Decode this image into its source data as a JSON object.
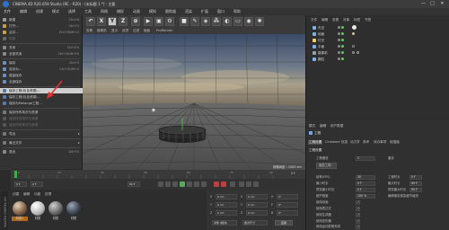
{
  "window": {
    "title": "CINEMA 4D R20.059 Studio (RC - R20) - [未标题 1 *] - 主要",
    "controls": [
      "—",
      "□",
      "✕"
    ]
  },
  "menubar": {
    "items": [
      "文件",
      "编辑",
      "创建",
      "模式",
      "选择",
      "工具",
      "网格",
      "捕捉",
      "动画",
      "模拟",
      "跟踪器",
      "渲染",
      "扩展",
      "窗口",
      "帮助"
    ]
  },
  "toolbar": {
    "buttons": [
      "X",
      "Y",
      "Z"
    ]
  },
  "file_menu": {
    "items": [
      {
        "label": "新建",
        "shortcut": "Ctrl+N"
      },
      {
        "label": "打开...",
        "shortcut": "Ctrl+O"
      },
      {
        "label": "合并...",
        "shortcut": "Ctrl+Shift+O"
      },
      {
        "label": "恢复",
        "shortcut": ""
      },
      {
        "label": "关闭",
        "shortcut": "Ctrl+F4"
      },
      {
        "label": "全部关闭",
        "shortcut": "Ctrl+Shift+F4"
      },
      {
        "label": "保存",
        "shortcut": "Ctrl+S"
      },
      {
        "label": "另存为...",
        "shortcut": "Ctrl+Shift+S"
      },
      {
        "label": "增量保存",
        "shortcut": ""
      },
      {
        "label": "全部保存",
        "shortcut": ""
      },
      {
        "label": "保存工程(包含资源)...",
        "shortcut": ""
      },
      {
        "label": "保存工程(包含资源)...",
        "shortcut": ""
      },
      {
        "label": "保存为Melange工程...",
        "shortcut": ""
      },
      {
        "label": "保存所有场次与资源",
        "shortcut": ""
      },
      {
        "label": "保存所有场次与资源",
        "shortcut": ""
      },
      {
        "label": "保存所有场次与资源",
        "shortcut": ""
      },
      {
        "label": "导出",
        "shortcut": ""
      },
      {
        "label": "最近文件",
        "shortcut": ""
      },
      {
        "label": "退出",
        "shortcut": "Alt+F4"
      }
    ]
  },
  "viewport": {
    "menu": [
      "查看",
      "摄像机",
      "显示",
      "选项",
      "过滤",
      "面板",
      "ProRender"
    ],
    "view_name": "透视视图",
    "grid_label": "网格间距 : 1000 cm"
  },
  "timeline": {
    "ticks": [
      "0",
      "5",
      "10",
      "15",
      "20",
      "25",
      "30",
      "35",
      "40",
      "45",
      "50",
      "55",
      "60",
      "65",
      "70",
      "75",
      "80",
      "85",
      "90"
    ],
    "frame_start": "0 F",
    "frame_end": "90 F",
    "current": "0 F"
  },
  "materials": {
    "menu": [
      "创建",
      "编辑",
      "功能",
      "纹理"
    ],
    "items": [
      "材质1",
      "材质",
      "材质",
      "材质"
    ]
  },
  "coords": {
    "rows": [
      {
        "axis": "X",
        "pos": "0 cm",
        "axis2": "X",
        "val2": "0 cm",
        "axis3": "H",
        "val3": "0°"
      },
      {
        "axis": "Y",
        "pos": "0 cm",
        "axis2": "Y",
        "val2": "0 cm",
        "axis3": "P",
        "val3": "0°"
      },
      {
        "axis": "Z",
        "pos": "0 cm",
        "axis2": "Z",
        "val2": "0 cm",
        "axis3": "B",
        "val3": "0°"
      }
    ],
    "mode": "对象 (相对)",
    "size_mode": "绝对尺寸",
    "apply": "应用"
  },
  "object_manager": {
    "menu": [
      "文件",
      "编辑",
      "查看",
      "对象",
      "标签",
      "书签"
    ],
    "objects": [
      "天空",
      "地面",
      "灯光",
      "平面",
      "摄像机",
      "圆柱"
    ]
  },
  "attributes": {
    "menu": [
      "模式",
      "编辑",
      "用户数据"
    ],
    "header": "工程",
    "tabs": [
      "工程设置",
      "Cineware",
      "信息",
      "动力学",
      "参考",
      "待办事项",
      "帧插值"
    ],
    "section": "工程设置",
    "rows": [
      {
        "label": "工程缩放",
        "value": "1",
        "label2": "厘米",
        "value2": ""
      },
      {
        "label": "缩放工程...",
        "value": "",
        "label2": "",
        "value2": ""
      },
      {
        "label": "帧率(FPS)",
        "value": "30",
        "label2": "工程时长",
        "value2": "0 F"
      },
      {
        "label": "最小时长",
        "value": "0 F",
        "label2": "最大时长",
        "value2": "90 F"
      },
      {
        "label": "预览最小时长",
        "value": "0 F",
        "label2": "预览最大时长",
        "value2": "90 F"
      },
      {
        "label": "细节程度",
        "value": "100 %",
        "label2": "编辑使用渲染细节级别",
        "value2": ""
      },
      {
        "label": "使用动画",
        "value": "✓",
        "label2": "",
        "value2": ""
      },
      {
        "label": "使用表达式",
        "value": "✓",
        "label2": "",
        "value2": ""
      },
      {
        "label": "使用生成器",
        "value": "✓",
        "label2": "",
        "value2": ""
      },
      {
        "label": "使用变形器",
        "value": "✓",
        "label2": "",
        "value2": ""
      },
      {
        "label": "使用运动剪辑系统",
        "value": "✓",
        "label2": "",
        "value2": ""
      }
    ]
  },
  "brand_vertical": "MAXON CINEMA 4D",
  "colors": {
    "accent": "#2f6fd0",
    "highlight": "#cfcfcf",
    "arrow": "#e03030",
    "panel": "#2e2e2e"
  }
}
